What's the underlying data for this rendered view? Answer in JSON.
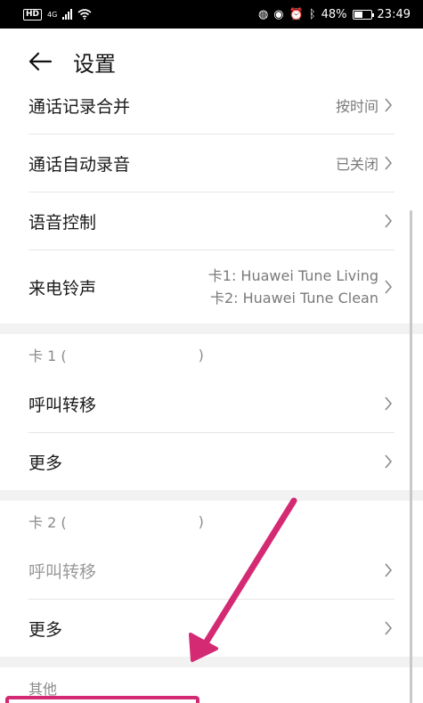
{
  "status_bar": {
    "hd": "HD",
    "network": "4G",
    "right_text": "48%",
    "time": "23:49"
  },
  "header": {
    "title": "设置"
  },
  "settings": {
    "merge_logs": {
      "label": "通话记录合并",
      "value": "按时间"
    },
    "auto_record": {
      "label": "通话自动录音",
      "value": "已关闭"
    },
    "voice_control": {
      "label": "语音控制"
    },
    "ringtone": {
      "label": "来电铃声",
      "card1": "卡1: Huawei Tune Living",
      "card2": "卡2: Huawei Tune Clean"
    }
  },
  "card1": {
    "header_prefix": "卡 1 (",
    "header_suffix": ")",
    "forwarding": "呼叫转移",
    "more": "更多"
  },
  "card2": {
    "header_prefix": "卡 2 (",
    "header_suffix": ")",
    "forwarding": "呼叫转移",
    "more": "更多"
  },
  "other": {
    "header": "其他"
  },
  "annotation": {
    "color": "#d42a73"
  }
}
